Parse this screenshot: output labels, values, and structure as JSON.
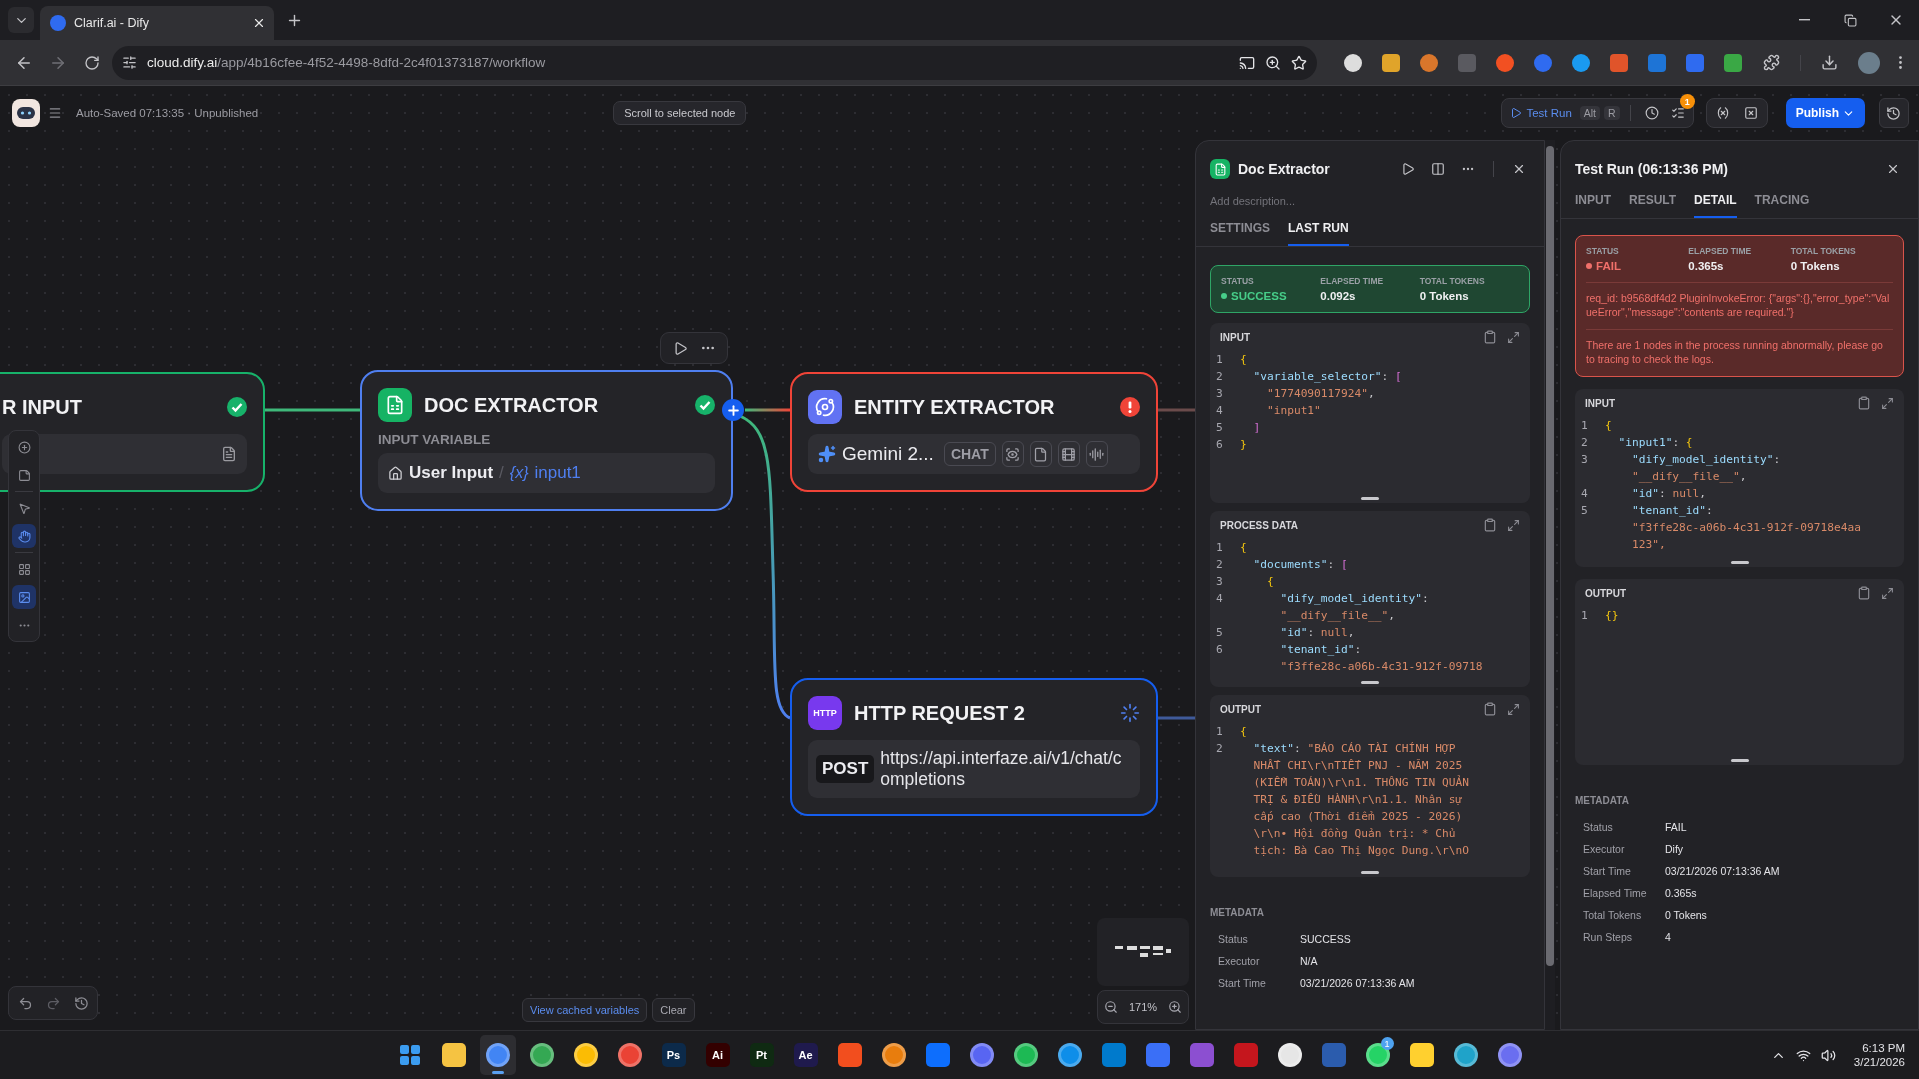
{
  "browser": {
    "tab_title": "Clarif.ai - Dify",
    "url_host": "cloud.dify.ai",
    "url_path": "/app/4b16cfee-4f52-4498-8dfd-2c4f01373187/workflow"
  },
  "header": {
    "save_status": "Auto-Saved 07:13:35 · Unpublished",
    "scroll_button": "Scroll to selected node",
    "test_run": "Test Run",
    "shortcut": [
      "Alt",
      "R"
    ],
    "badge": "1",
    "publish": "Publish"
  },
  "canvas": {
    "tools": [
      {
        "kind": "add",
        "selected": false
      },
      {
        "kind": "note",
        "selected": false
      },
      {
        "kind": "pointer",
        "selected": false
      },
      {
        "kind": "hand",
        "selected": true
      },
      {
        "kind": "organize",
        "selected": false
      },
      {
        "kind": "minimap",
        "selected": true
      },
      {
        "kind": "more",
        "selected": false
      }
    ],
    "nodes": [
      {
        "kind": "start",
        "title": "R INPUT",
        "succeeded": true,
        "failed": false,
        "running": false,
        "selected": false
      },
      {
        "kind": "doc",
        "title": "DOC EXTRACTOR",
        "succeeded": true,
        "failed": false,
        "running": false,
        "selected": true,
        "label": "INPUT VARIABLE",
        "source": "User Input",
        "separator": "/",
        "var_mark": "{x}",
        "variable": "input1"
      },
      {
        "kind": "llm",
        "title": "ENTITY EXTRACTOR",
        "succeeded": false,
        "failed": true,
        "running": false,
        "selected": false,
        "model": "Gemini 2...",
        "mode": "CHAT"
      },
      {
        "kind": "http",
        "title": "HTTP REQUEST 2",
        "succeeded": false,
        "failed": false,
        "running": true,
        "selected": false,
        "icon_text": "HTTP",
        "method": "POST",
        "url": "https://api.interfaze.ai/v1/chat/completions"
      }
    ],
    "cached_button": "View cached variables",
    "clear_button": "Clear",
    "zoom": "171%"
  },
  "doc_panel": {
    "title": "Doc Extractor",
    "description_placeholder": "Add description...",
    "tabs": [
      {
        "label": "SETTINGS",
        "selected": false
      },
      {
        "label": "LAST RUN",
        "selected": true
      }
    ],
    "status": {
      "kind": "success",
      "fields": [
        {
          "label": "STATUS",
          "value": "SUCCESS"
        },
        {
          "label": "ELAPSED TIME",
          "value": "0.092s"
        },
        {
          "label": "TOTAL TOKENS",
          "value": "0 Tokens"
        }
      ]
    },
    "sections": [
      {
        "title": "INPUT",
        "lines": [
          {
            "num": "1",
            "text": "{"
          },
          {
            "num": "2",
            "text": "  \"variable_selector\": ["
          },
          {
            "num": "3",
            "text": "    \"1774090117924\","
          },
          {
            "num": "4",
            "text": "    \"input1\""
          },
          {
            "num": "5",
            "text": "  ]"
          },
          {
            "num": "6",
            "text": "}"
          }
        ]
      },
      {
        "title": "PROCESS DATA",
        "lines": [
          {
            "num": "1",
            "text": "{"
          },
          {
            "num": "2",
            "text": "  \"documents\": ["
          },
          {
            "num": "3",
            "text": "    {"
          },
          {
            "num": "4",
            "text": "      \"dify_model_identity\":"
          },
          {
            "text": "      \"__dify__file__\","
          },
          {
            "num": "5",
            "text": "      \"id\": null,"
          },
          {
            "num": "6",
            "text": "      \"tenant_id\":"
          },
          {
            "text": "      \"f3ffe28c-a06b-4c31-912f-09718"
          }
        ]
      },
      {
        "title": "OUTPUT",
        "lines": [
          {
            "num": "1",
            "text": "{"
          },
          {
            "num": "2",
            "text": "  \"text\": \"BÁO CÁO TÀI CHÍNH HỢP"
          },
          {
            "text": "  NHẤT CHI\\r\\nTIẾT PNJ - NĂM 2025",
            "cont": true
          },
          {
            "text": "  (KIỂM TOÁN)\\r\\n1. THÔNG TIN QUẢN",
            "cont": true
          },
          {
            "text": "  TRỊ & ĐIỀU HÀNH\\r\\n1.1. Nhân sự",
            "cont": true
          },
          {
            "text": "  cấp cao (Thời điểm 2025 - 2026)",
            "cont": true
          },
          {
            "text": "  \\r\\n• Hội đồng Quản trị: * Chủ",
            "cont": true
          },
          {
            "text": "  tịch: Bà Cao Thị Ngọc Dung.\\r\\nO",
            "cont": true
          }
        ]
      }
    ],
    "metadata_title": "METADATA",
    "metadata": [
      {
        "label": "Status",
        "value": "SUCCESS"
      },
      {
        "label": "Executor",
        "value": "N/A"
      },
      {
        "label": "Start Time",
        "value": "03/21/2026 07:13:36 AM"
      }
    ]
  },
  "test_run_panel": {
    "title": "Test Run (06:13:36 PM)",
    "tabs": [
      {
        "label": "INPUT",
        "selected": false
      },
      {
        "label": "RESULT",
        "selected": false
      },
      {
        "label": "DETAIL",
        "selected": true
      },
      {
        "label": "TRACING",
        "selected": false
      }
    ],
    "status": {
      "kind": "fail",
      "fields": [
        {
          "label": "STATUS",
          "value": "FAIL"
        },
        {
          "label": "ELAPSED TIME",
          "value": "0.365s"
        },
        {
          "label": "TOTAL TOKENS",
          "value": "0 Tokens"
        }
      ],
      "error": "req_id: b9568df4d2 PluginInvokeError: {\"args\":{},\"error_type\":\"ValueError\",\"message\":\"contents are required.\"}",
      "notice": "There are 1 nodes in the process running abnormally, please go to tracing to check the logs."
    },
    "sections": [
      {
        "title": "INPUT",
        "lines": [
          {
            "num": "1",
            "text": "{"
          },
          {
            "num": "2",
            "text": "  \"input1\": {"
          },
          {
            "num": "3",
            "text": "    \"dify_model_identity\":"
          },
          {
            "text": "    \"__dify__file__\","
          },
          {
            "num": "4",
            "text": "    \"id\": null,"
          },
          {
            "num": "5",
            "text": "    \"tenant_id\":"
          },
          {
            "text": "    \"f3ffe28c-a06b-4c31-912f-09718e4aa"
          },
          {
            "text": "    123\",",
            "cont": true
          }
        ]
      },
      {
        "title": "OUTPUT",
        "lines": [
          {
            "num": "1",
            "text": "{}"
          }
        ]
      }
    ],
    "metadata_title": "METADATA",
    "metadata": [
      {
        "label": "Status",
        "value": "FAIL"
      },
      {
        "label": "Executor",
        "value": "Dify"
      },
      {
        "label": "Start Time",
        "value": "03/21/2026 07:13:36 AM"
      },
      {
        "label": "Elapsed Time",
        "value": "0.365s"
      },
      {
        "label": "Total Tokens",
        "value": "0 Tokens"
      },
      {
        "label": "Run Steps",
        "value": "4"
      }
    ]
  },
  "taskbar": {
    "apps": [
      {
        "kind": "start",
        "selected": false
      },
      {
        "kind": "folder",
        "selected": false
      },
      {
        "kind": "round",
        "color": "#4285f4",
        "selected": true
      },
      {
        "kind": "round",
        "color": "#34a853",
        "selected": false
      },
      {
        "kind": "round",
        "color": "#fbbc04",
        "selected": false
      },
      {
        "kind": "round",
        "color": "#ea4335",
        "selected": false
      },
      {
        "kind": "tile",
        "color": "#0c2a4a",
        "label": "Ps",
        "selected": false
      },
      {
        "kind": "tile",
        "color": "#330000",
        "label": "Ai",
        "selected": false
      },
      {
        "kind": "tile",
        "color": "#0f2a12",
        "label": "Pt",
        "selected": false
      },
      {
        "kind": "tile",
        "color": "#1f1a4d",
        "label": "Ae",
        "selected": false
      },
      {
        "kind": "tile",
        "color": "#f24e1e",
        "selected": false
      },
      {
        "kind": "round",
        "color": "#e87d0d",
        "selected": false
      },
      {
        "kind": "tile",
        "color": "#0d6efd",
        "selected": false
      },
      {
        "kind": "round",
        "color": "#5865f2",
        "selected": false
      },
      {
        "kind": "round",
        "color": "#1db954",
        "selected": false
      },
      {
        "kind": "round",
        "color": "#0e8ee9",
        "selected": false
      },
      {
        "kind": "tile",
        "color": "#007acc",
        "selected": false
      },
      {
        "kind": "tile",
        "color": "#3a6ff7",
        "selected": false
      },
      {
        "kind": "tile",
        "color": "#8c4fd1",
        "selected": false
      },
      {
        "kind": "tile",
        "color": "#c5161d",
        "selected": false
      },
      {
        "kind": "round",
        "color": "#e6e6e6",
        "selected": false
      },
      {
        "kind": "tile",
        "color": "#2b5cad",
        "selected": false
      },
      {
        "kind": "round",
        "color": "#25d366",
        "badge": "1",
        "selected": false
      },
      {
        "kind": "tile",
        "color": "#ffd02f",
        "selected": false
      },
      {
        "kind": "round",
        "color": "#1fa3c9",
        "selected": false
      },
      {
        "kind": "round",
        "color": "#6a6ef0",
        "selected": false
      }
    ],
    "time": "6:13 PM",
    "date": "3/21/2026"
  }
}
